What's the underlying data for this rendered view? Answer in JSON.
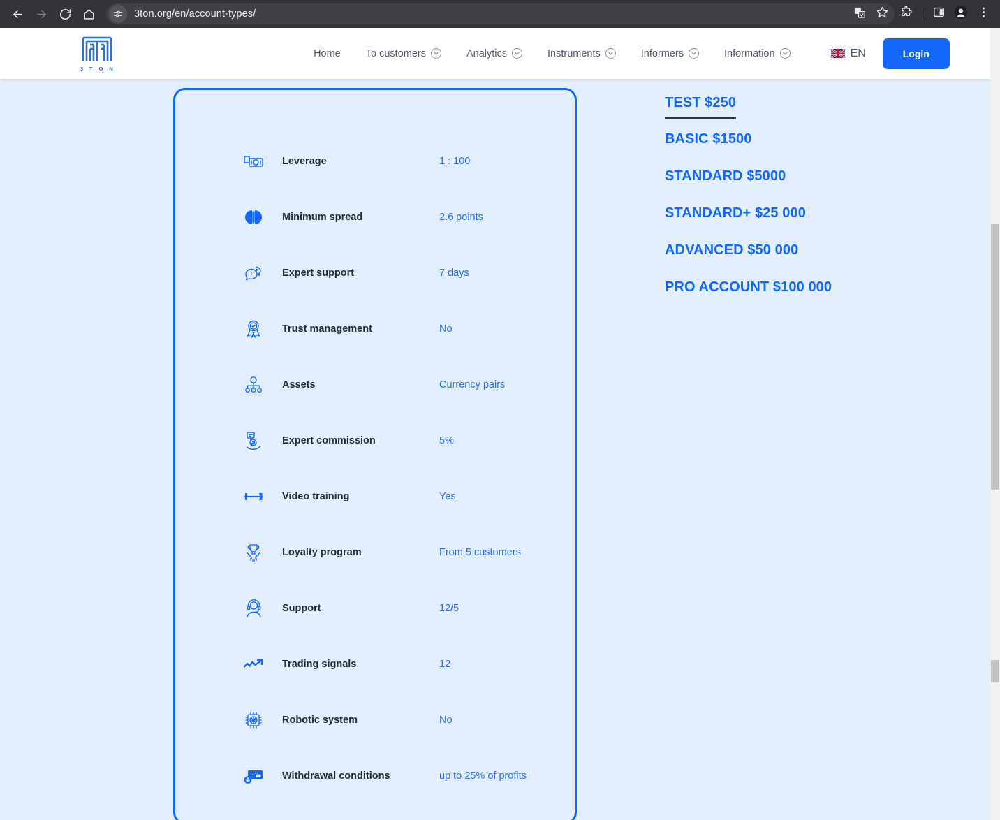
{
  "browser": {
    "back_icon": "back-arrow-icon",
    "forward_icon": "forward-arrow-icon",
    "reload_icon": "reload-icon",
    "home_icon": "home-icon",
    "site_info_icon": "site-settings-icon",
    "url": "3ton.org/en/account-types/",
    "url_placeholder": "Search Google or type a URL",
    "translate_icon": "translate-icon",
    "bookmark_icon": "star-icon",
    "extensions_icon": "extensions-puzzle-icon",
    "side_panel_icon": "side-panel-icon",
    "profile_icon": "profile-avatar-icon",
    "menu_icon": "three-dot-menu-icon"
  },
  "site_header": {
    "logo_word": "3 T O N",
    "nav": [
      {
        "label": "Home",
        "has_chevron": false
      },
      {
        "label": "To customers",
        "has_chevron": true
      },
      {
        "label": "Analytics",
        "has_chevron": true
      },
      {
        "label": "Instruments",
        "has_chevron": true
      },
      {
        "label": "Informers",
        "has_chevron": true
      },
      {
        "label": "Information",
        "has_chevron": true
      }
    ],
    "language": {
      "code": "EN",
      "flag": "uk-flag-icon"
    },
    "login_label": "Login"
  },
  "spec_card": {
    "rows": [
      {
        "icon": "leverage-money-icon",
        "label": "Leverage",
        "value": "1 : 100"
      },
      {
        "icon": "spread-icon",
        "label": "Minimum spread",
        "value": "2.6 points"
      },
      {
        "icon": "expert-support-chat-icon",
        "label": "Expert support",
        "value": "7 days"
      },
      {
        "icon": "trust-management-badge-icon",
        "label": "Trust management",
        "value": "No"
      },
      {
        "icon": "assets-network-icon",
        "label": "Assets",
        "value": "Currency pairs"
      },
      {
        "icon": "expert-commission-hand-icon",
        "label": "Expert commission",
        "value": "5%"
      },
      {
        "icon": "video-training-icon",
        "label": "Video training",
        "value": "Yes"
      },
      {
        "icon": "loyalty-trophy-hands-icon",
        "label": "Loyalty program",
        "value": "From 5 customers"
      },
      {
        "icon": "support-headset-icon",
        "label": "Support",
        "value": "12/5"
      },
      {
        "icon": "trading-signals-chart-icon",
        "label": "Trading signals",
        "value": "12"
      },
      {
        "icon": "robotic-system-chip-icon",
        "label": "Robotic system",
        "value": "No"
      },
      {
        "icon": "withdrawal-card-icon",
        "label": "Withdrawal conditions",
        "value": "up to 25% of profits"
      }
    ]
  },
  "account_types": {
    "items": [
      {
        "label": "TEST $250",
        "active": true
      },
      {
        "label": "BASIC $1500",
        "active": false
      },
      {
        "label": "STANDARD $5000",
        "active": false
      },
      {
        "label": "STANDARD+ $25 000",
        "active": false
      },
      {
        "label": "ADVANCED $50 000",
        "active": false
      },
      {
        "label": "PRO ACCOUNT $100 000",
        "active": false
      }
    ]
  },
  "colors": {
    "page_background": "#e2eefb",
    "accent_blue": "#1368fa",
    "value_blue": "#2b6ef0",
    "label_dark": "#222b36",
    "nav_gray": "#4e5a6b",
    "browser_chrome": "#333438",
    "scrollbar_thumb": "#c1c1c1"
  }
}
